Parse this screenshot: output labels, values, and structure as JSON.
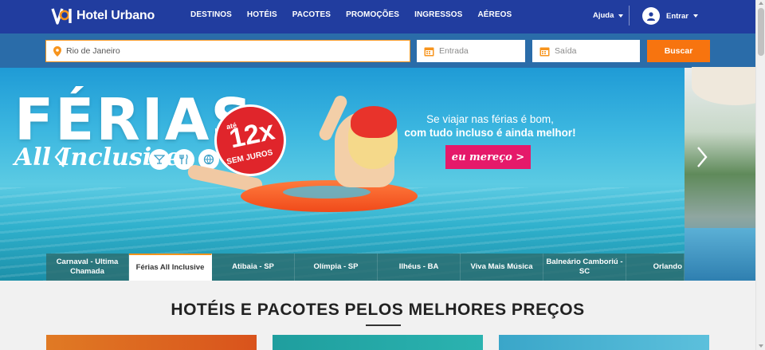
{
  "header": {
    "logo_text": "Hotel Urbano",
    "nav": [
      "DESTINOS",
      "HOTÉIS",
      "PACOTES",
      "PROMOÇÕES",
      "INGRESSOS",
      "AÉREOS"
    ],
    "help_label": "Ajuda",
    "login_label": "Entrar"
  },
  "search": {
    "destination_value": "Rio de Janeiro",
    "checkin_placeholder": "Entrada",
    "checkout_placeholder": "Saída",
    "submit_label": "Buscar"
  },
  "banner": {
    "headline": "FÉRIAS",
    "subheadline": "All Inclusive",
    "installments_prefix": "até",
    "installments_value": "12x",
    "installments_suffix": "SEM JUROS",
    "tagline_line1": "Se viajar nas férias é bom,",
    "tagline_line2": "com tudo incluso é ainda melhor!",
    "cta_label": "eu mereço >"
  },
  "categories": [
    {
      "label": "Carnaval - Ultima Chamada",
      "active": false
    },
    {
      "label": "Férias All Inclusive",
      "active": true
    },
    {
      "label": "Atibaia - SP",
      "active": false
    },
    {
      "label": "Olímpia - SP",
      "active": false
    },
    {
      "label": "Ilhéus - BA",
      "active": false
    },
    {
      "label": "Viva Mais Música",
      "active": false
    },
    {
      "label": "Balneário Camboriú - SC",
      "active": false
    },
    {
      "label": "Orlando",
      "active": false
    }
  ],
  "section": {
    "title": "HOTÉIS E PACOTES PELOS MELHORES PREÇOS"
  },
  "colors": {
    "header_bg": "#213d9f",
    "search_bg": "#2a6ca9",
    "accent_orange": "#f7740f",
    "cta_pink": "#e5196a",
    "badge_red": "#e0252b"
  },
  "icons": [
    "logo-icon",
    "chevron-down-icon",
    "user-icon",
    "location-pin-icon",
    "calendar-icon",
    "cocktail-icon",
    "cutlery-icon",
    "ball-icon",
    "chevron-left-icon",
    "chevron-right-icon"
  ]
}
